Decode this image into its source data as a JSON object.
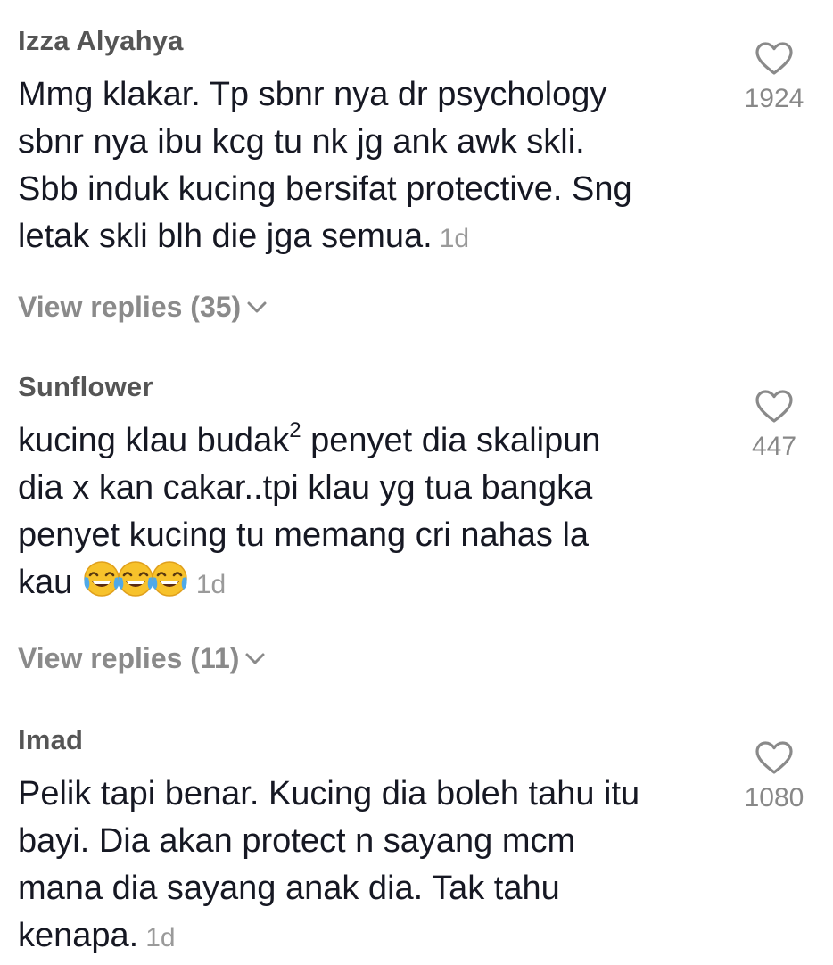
{
  "comments": [
    {
      "username": "Izza Alyahya",
      "lines": [
        "Mmg klakar. Tp sbnr nya dr psychology",
        "sbnr nya ibu kcg tu nk jg ank awk skli.",
        "Sbb induk kucing bersifat protective. Sng",
        "letak skli blh die jga semua."
      ],
      "time": "1d",
      "likes": "1924",
      "view_replies": "View replies (35)"
    },
    {
      "username": "Sunflower",
      "text_a": "kucing klau budak",
      "superscript": "2",
      "text_b": " penyet dia skalipun\ndia x kan cakar..tpi klau yg tua bangka\npenyet kucing tu memang cri nahas la\nkau ",
      "emojis": [
        "face-with-tears-of-joy",
        "face-with-tears-of-joy",
        "face-with-tears-of-joy"
      ],
      "time": "1d",
      "likes": "447",
      "view_replies": "View replies (11)"
    },
    {
      "username": "Imad",
      "lines": [
        "Pelik tapi benar. Kucing dia boleh tahu itu",
        "bayi. Dia akan protect n sayang mcm",
        "mana dia sayang anak dia. Tak tahu",
        "kenapa."
      ],
      "time": "1d",
      "likes": "1080"
    }
  ]
}
